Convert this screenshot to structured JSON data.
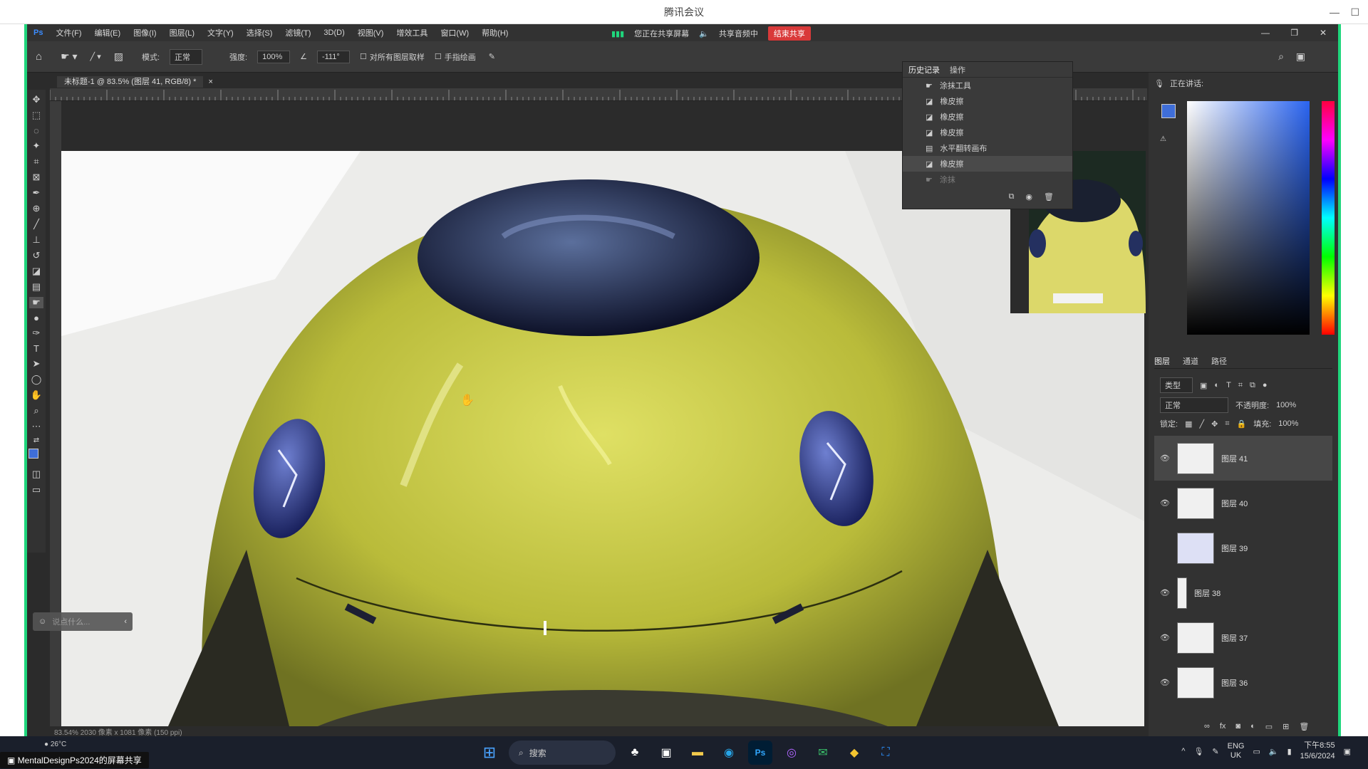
{
  "meeting": {
    "title": "腾讯会议"
  },
  "menu": [
    "文件(F)",
    "编辑(E)",
    "图像(I)",
    "图层(L)",
    "文字(Y)",
    "选择(S)",
    "滤镜(T)",
    "3D(D)",
    "视图(V)",
    "增效工具",
    "窗口(W)",
    "帮助(H)"
  ],
  "share": {
    "status": "您正在共享屏幕",
    "audio": "共享音频中",
    "stop": "结束共享"
  },
  "options": {
    "mode_label": "模式:",
    "mode_value": "正常",
    "strength_label": "强度:",
    "strength_value": "100%",
    "angle_value": "-111°",
    "sample_all": "对所有图层取样",
    "finger": "手指绘画"
  },
  "document": {
    "tab": "未标题-1 @ 83.5% (图层 41, RGB/8) *",
    "status": "83.54%  2030 像素 x 1081 像素 (150 ppi)"
  },
  "history": {
    "tabs": [
      "历史记录",
      "操作"
    ],
    "rows": [
      {
        "label": "涂抹工具",
        "icon": "smudge-icon"
      },
      {
        "label": "橡皮擦",
        "icon": "eraser-icon"
      },
      {
        "label": "橡皮擦",
        "icon": "eraser-icon"
      },
      {
        "label": "橡皮擦",
        "icon": "eraser-icon"
      },
      {
        "label": "水平翻转画布",
        "icon": "flip-icon"
      },
      {
        "label": "橡皮擦",
        "icon": "eraser-icon"
      },
      {
        "label": "涂抹",
        "icon": "smudge-icon"
      }
    ]
  },
  "color": {
    "header": "正在讲话:",
    "fg": "#3f6ed8",
    "bg": "#e8d83a"
  },
  "layers": {
    "tabs": [
      "图层",
      "通道",
      "路径"
    ],
    "filter": "类型",
    "blend": "正常",
    "opacity_label": "不透明度:",
    "opacity": "100%",
    "lock_label": "锁定:",
    "fill_label": "填充:",
    "fill": "100%",
    "items": [
      {
        "name": "图层 41",
        "selected": true,
        "visible": true
      },
      {
        "name": "图层 40",
        "selected": false,
        "visible": true
      },
      {
        "name": "图层 39",
        "selected": false,
        "visible": false
      },
      {
        "name": "图层 38",
        "selected": false,
        "visible": true
      },
      {
        "name": "图层 37",
        "selected": false,
        "visible": true
      },
      {
        "name": "图层 36",
        "selected": false,
        "visible": true
      }
    ]
  },
  "chat": {
    "placeholder": "说点什么..."
  },
  "taskbar": {
    "share_label": "MentalDesignPs2024的屏幕共享",
    "weather": "26°C",
    "search": "搜索",
    "lang": "ENG",
    "region": "UK",
    "time": "下午8:55",
    "date": "15/6/2024"
  },
  "colors": {
    "accent": "#1fd67c",
    "stop": "#d93a3a",
    "car": "#d7d83c"
  }
}
